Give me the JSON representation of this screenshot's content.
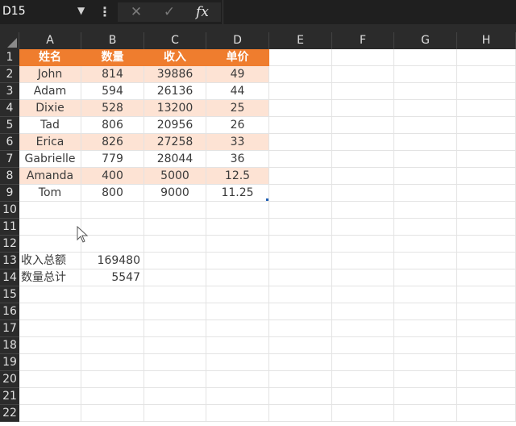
{
  "formula_bar": {
    "name_box": "D15",
    "fx_label": "fx",
    "cancel_symbol": "✕",
    "enter_symbol": "✓",
    "formula_value": ""
  },
  "columns": [
    "A",
    "B",
    "C",
    "D",
    "E",
    "F",
    "G",
    "H"
  ],
  "rows": [
    "1",
    "2",
    "3",
    "4",
    "5",
    "6",
    "7",
    "8",
    "9",
    "10",
    "11",
    "12",
    "13",
    "14",
    "15",
    "16",
    "17",
    "18",
    "19",
    "20",
    "21",
    "22"
  ],
  "table": {
    "headers": [
      "姓名",
      "数量",
      "收入",
      "单价"
    ],
    "rows": [
      [
        "John",
        "814",
        "39886",
        "49"
      ],
      [
        "Adam",
        "594",
        "26136",
        "44"
      ],
      [
        "Dixie",
        "528",
        "13200",
        "25"
      ],
      [
        "Tad",
        "806",
        "20956",
        "26"
      ],
      [
        "Erica",
        "826",
        "27258",
        "33"
      ],
      [
        "Gabrielle",
        "779",
        "28044",
        "36"
      ],
      [
        "Amanda",
        "400",
        "5000",
        "12.5"
      ],
      [
        "Tom",
        "800",
        "9000",
        "11.25"
      ]
    ]
  },
  "summary": [
    {
      "label": "收入总额",
      "value": "169480"
    },
    {
      "label": "数量总计",
      "value": "5547"
    }
  ],
  "colors": {
    "header_fill": "#ef7d2e",
    "band_fill": "#fde3d4",
    "chrome": "#2b2b2b"
  }
}
